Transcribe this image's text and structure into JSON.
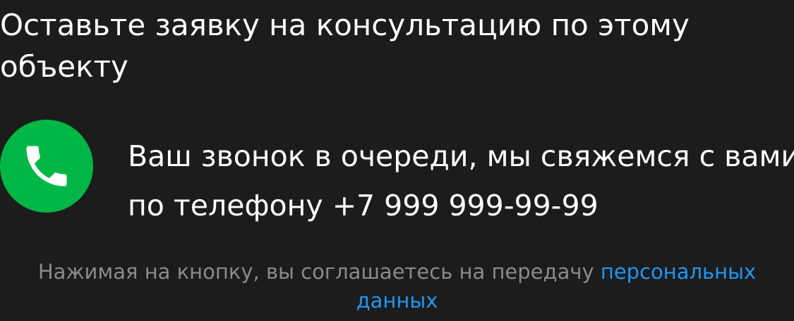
{
  "form": {
    "title": "Оставьте заявку на консультацию по этому объекту",
    "status_line_1": "Ваш звонок в очереди, мы свяжемся с вами",
    "status_line_2": "по телефону +7 999 999-99-99",
    "phone_icon": "phone-icon",
    "consent_text": "Нажимая на кнопку, вы соглашаетесь на передачу ",
    "consent_link": "персональных данных"
  },
  "colors": {
    "background": "#1c1c1c",
    "accent_green": "#00b745",
    "link": "#2196f3",
    "muted_text": "#8a8a8a"
  }
}
